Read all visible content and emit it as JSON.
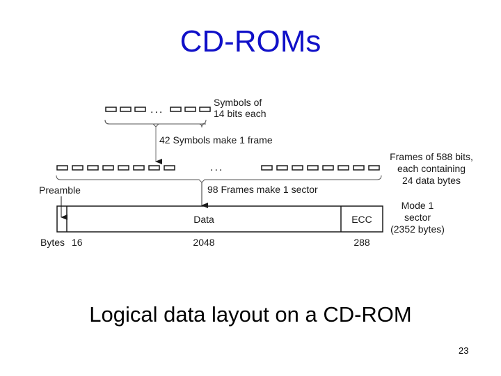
{
  "slide": {
    "title": "CD-ROMs",
    "caption": "Logical data layout on a CD-ROM",
    "page_number": "23",
    "title_color": "#1010c8"
  },
  "diagram": {
    "symbols_label_line1": "Symbols of",
    "symbols_label_line2": "14 bits each",
    "symbols_to_frame": "42 Symbols make 1 frame",
    "frames_label_line1": "Frames of 588 bits,",
    "frames_label_line2": "each containing",
    "frames_label_line3": "24 data bytes",
    "frames_to_sector": "98 Frames make 1 sector",
    "ellipsis": "...",
    "preamble_label": "Preamble",
    "sector_fields": [
      {
        "name": "Preamble",
        "label": "",
        "bytes": "16"
      },
      {
        "name": "Data",
        "label": "Data",
        "bytes": "2048"
      },
      {
        "name": "ECC",
        "label": "ECC",
        "bytes": "288"
      }
    ],
    "bytes_label": "Bytes",
    "sector_label_line1": "Mode 1",
    "sector_label_line2": "sector",
    "sector_label_line3": "(2352 bytes)"
  }
}
